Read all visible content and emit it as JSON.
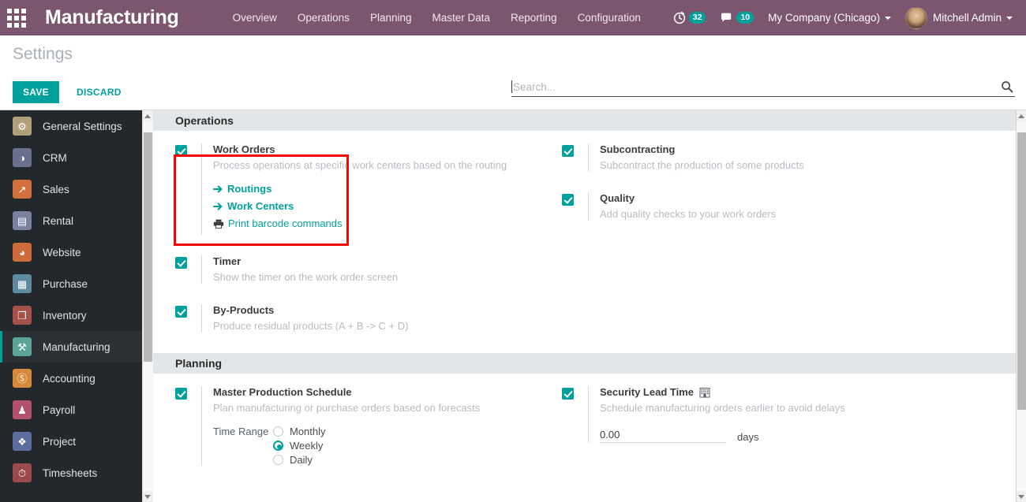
{
  "topbar": {
    "apps_icon": "apps-grid-icon",
    "brand": "Manufacturing",
    "menu": [
      {
        "label": "Overview"
      },
      {
        "label": "Operations"
      },
      {
        "label": "Planning"
      },
      {
        "label": "Master Data"
      },
      {
        "label": "Reporting"
      },
      {
        "label": "Configuration"
      }
    ],
    "activities_icon": "clock-icon",
    "activities_count": "32",
    "messages_icon": "chat-bubble-icon",
    "messages_count": "10",
    "company": "My Company (Chicago)",
    "user": "Mitchell Admin",
    "accent": "#7c566e"
  },
  "controlpanel": {
    "title": "Settings",
    "save_label": "SAVE",
    "discard_label": "DISCARD",
    "save_color": "#00a09d"
  },
  "search": {
    "value": "",
    "placeholder": "Search...",
    "icon": "magnifier-icon"
  },
  "sidebar": {
    "items": [
      {
        "label": "General Settings",
        "icon": "gear-icon",
        "bg": "#b0a07a",
        "glyph": "⚙",
        "active": false
      },
      {
        "label": "CRM",
        "icon": "handshake-icon",
        "bg": "#6b6f8e",
        "glyph": "◑",
        "active": false
      },
      {
        "label": "Sales",
        "icon": "chart-up-icon",
        "bg": "#d2703c",
        "glyph": "↗",
        "active": false
      },
      {
        "label": "Rental",
        "icon": "document-icon",
        "bg": "#7b7fa0",
        "glyph": "▤",
        "active": false
      },
      {
        "label": "Website",
        "icon": "globe-icon",
        "bg": "#cf6a3c",
        "glyph": "◕",
        "active": false
      },
      {
        "label": "Purchase",
        "icon": "card-icon",
        "bg": "#5d8aa0",
        "glyph": "▦",
        "active": false
      },
      {
        "label": "Inventory",
        "icon": "box-icon",
        "bg": "#a8504a",
        "glyph": "❐",
        "active": false
      },
      {
        "label": "Manufacturing",
        "icon": "wrench-icon",
        "bg": "#5aa598",
        "glyph": "⚒",
        "active": true
      },
      {
        "label": "Accounting",
        "icon": "invoice-icon",
        "bg": "#d88a3c",
        "glyph": "Ⓢ",
        "active": false
      },
      {
        "label": "Payroll",
        "icon": "person-badge-icon",
        "bg": "#b3506b",
        "glyph": "♟",
        "active": false
      },
      {
        "label": "Project",
        "icon": "puzzle-icon",
        "bg": "#5d6d9e",
        "glyph": "❖",
        "active": false
      },
      {
        "label": "Timesheets",
        "icon": "stopwatch-icon",
        "bg": "#9b4a4a",
        "glyph": "⏱",
        "active": false
      }
    ]
  },
  "settings": {
    "sections": [
      {
        "title": "Operations",
        "left": [
          {
            "name": "work-orders",
            "checked": true,
            "title": "Work Orders",
            "desc": "Process operations at specific work centers based on the routing",
            "links": [
              {
                "label": "Routings",
                "icon": "arrow-right-icon",
                "style": "bold"
              },
              {
                "label": "Work Centers",
                "icon": "arrow-right-icon",
                "style": "bold"
              },
              {
                "label": "Print barcode commands",
                "icon": "printer-icon",
                "style": "plain"
              }
            ],
            "highlighted": true
          },
          {
            "name": "timer",
            "checked": true,
            "title": "Timer",
            "desc": "Show the timer on the work order screen"
          },
          {
            "name": "by-products",
            "checked": true,
            "title": "By-Products",
            "desc": "Produce residual products (A + B -> C + D)"
          }
        ],
        "right": [
          {
            "name": "subcontracting",
            "checked": true,
            "title": "Subcontracting",
            "desc": "Subcontract the production of some products"
          },
          {
            "name": "quality",
            "checked": true,
            "title": "Quality",
            "desc": "Add quality checks to your work orders"
          }
        ]
      },
      {
        "title": "Planning",
        "left": [
          {
            "name": "master-production-schedule",
            "checked": true,
            "title": "Master Production Schedule",
            "desc": "Plan manufacturing or purchase orders based on forecasts",
            "radio_group": {
              "label": "Time Range",
              "options": [
                {
                  "label": "Monthly",
                  "selected": false
                },
                {
                  "label": "Weekly",
                  "selected": true
                },
                {
                  "label": "Daily",
                  "selected": false
                }
              ]
            }
          }
        ],
        "right": [
          {
            "name": "security-lead-time",
            "checked": true,
            "title": "Security Lead Time",
            "title_icon": "building-icon",
            "desc": "Schedule manufacturing orders earlier to avoid delays",
            "field_value": "0.00",
            "field_unit": "days"
          }
        ]
      }
    ]
  },
  "annotation": {
    "color": "#ff0000",
    "target": "work-orders"
  },
  "scrollbars": {
    "left": {
      "thumb_top_pct": 3,
      "thumb_height_pct": 62
    },
    "right": {
      "thumb_top_pct": 3,
      "thumb_height_pct": 75
    }
  }
}
